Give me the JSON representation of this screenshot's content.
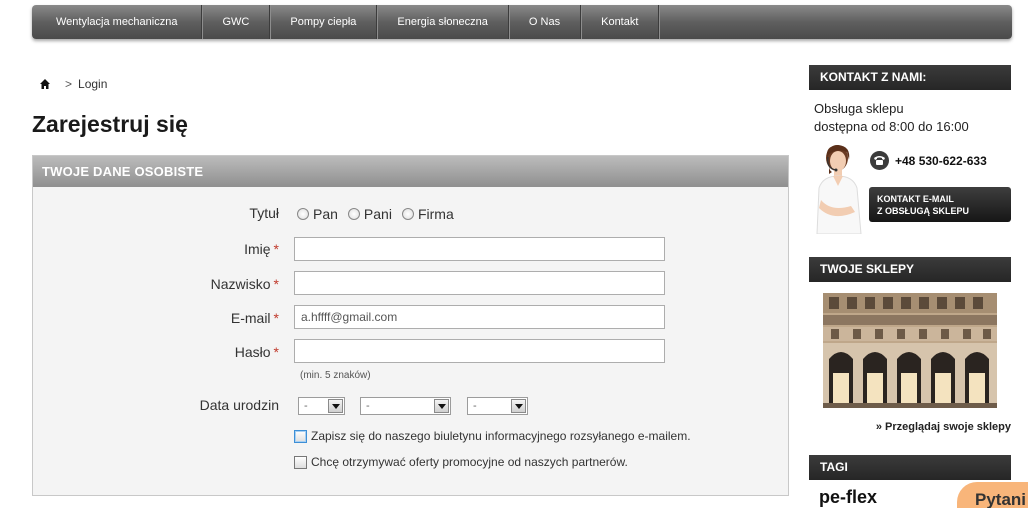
{
  "nav": {
    "items": [
      "Wentylacja mechaniczna",
      "GWC",
      "Pompy ciepła",
      "Energia słoneczna",
      "O Nas",
      "Kontakt"
    ]
  },
  "breadcrumb": {
    "separator": ">",
    "current": "Login"
  },
  "page": {
    "title": "Zarejestruj się"
  },
  "form": {
    "section_title": "TWOJE DANE OSOBISTE",
    "title_label": "Tytuł",
    "title_options": [
      "Pan",
      "Pani",
      "Firma"
    ],
    "first_name_label": "Imię",
    "last_name_label": "Nazwisko",
    "email_label": "E-mail",
    "email_value": "a.hffff@gmail.com",
    "password_label": "Hasło",
    "password_hint": "(min. 5 znaków)",
    "birthdate_label": "Data urodzin",
    "birthdate_placeholder": "-",
    "required_mark": "*",
    "newsletter_label": "Zapisz się do naszego biuletynu informacyjnego rozsyłanego e-mailem.",
    "partners_label": "Chcę otrzymywać oferty promocyjne od naszych partnerów."
  },
  "sidebar": {
    "contact_title": "KONTAKT Z NAMI:",
    "service_line1": "Obsługa sklepu",
    "service_line2": "dostępna od 8:00 do 16:00",
    "phone": "+48 530-622-633",
    "email_button_line1": "KONTAKT E-MAIL",
    "email_button_line2": "Z OBSŁUGĄ SKLEPU",
    "shops_title": "TWOJE SKLEPY",
    "shops_link": "» Przeglądaj swoje sklepy",
    "tags_title": "TAGI",
    "tag1": "pe-flex"
  },
  "chat": {
    "label": "Pytani"
  },
  "colors": {
    "accent_dark": "#262626",
    "required": "#c0392b",
    "chat": "#f8b57a"
  }
}
